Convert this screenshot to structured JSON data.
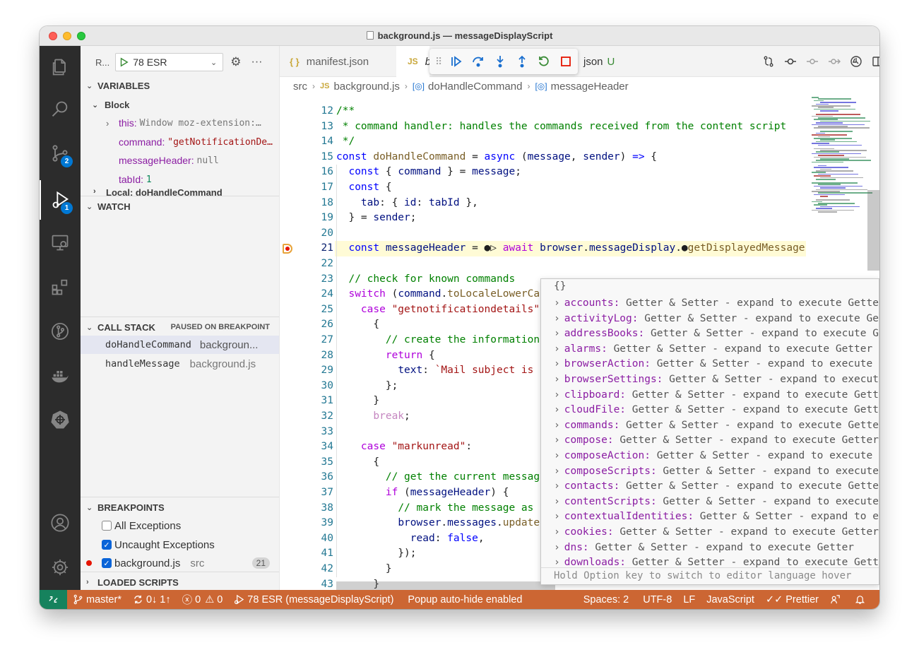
{
  "window": {
    "title": "background.js — messageDisplayScript"
  },
  "activity": {
    "scm_badge": "2",
    "debug_badge": "1"
  },
  "run": {
    "short_label": "R...",
    "config": "78 ESR"
  },
  "variables": {
    "header": "VARIABLES",
    "scope": "Block",
    "items": [
      {
        "name": "this:",
        "value": "Window moz-extension:…",
        "kind": "dim",
        "expandable": true
      },
      {
        "name": "command:",
        "value": "\"getNotificationDe…",
        "kind": "str",
        "expandable": false
      },
      {
        "name": "messageHeader:",
        "value": "null",
        "kind": "dim",
        "expandable": false
      },
      {
        "name": "tabId:",
        "value": "1",
        "kind": "num",
        "expandable": false
      }
    ],
    "local_scope": "Local: doHandleCommand"
  },
  "watch": {
    "header": "WATCH"
  },
  "callstack": {
    "header": "CALL STACK",
    "status": "PAUSED ON BREAKPOINT",
    "frames": [
      {
        "fn": "doHandleCommand",
        "file": "backgroun..."
      },
      {
        "fn": "handleMessage",
        "file": "background.js"
      }
    ]
  },
  "breakpoints": {
    "header": "BREAKPOINTS",
    "items": [
      {
        "label": "All Exceptions",
        "checked": false
      },
      {
        "label": "Uncaught Exceptions",
        "checked": true
      },
      {
        "label": "background.js",
        "checked": true,
        "path": "src",
        "line": "21"
      }
    ]
  },
  "loaded_scripts": {
    "header": "LOADED SCRIPTS"
  },
  "tabs": [
    {
      "icon": "{ }",
      "label": "manifest.json"
    },
    {
      "icon": "JS",
      "label": "b"
    },
    {
      "label": "json",
      "status": "U"
    }
  ],
  "breadcrumbs": [
    "src",
    "background.js",
    "doHandleCommand",
    "messageHeader"
  ],
  "code_lines": [
    {
      "n": "12",
      "html": "<span class='c'>/**</span>"
    },
    {
      "n": "13",
      "html": "<span class='c'> * command handler: handles the commands received from the content script</span>"
    },
    {
      "n": "14",
      "html": "<span class='c'> */</span>"
    },
    {
      "n": "15",
      "html": "<span class='k'>const</span> <span class='f'>doHandleCommand</span> = <span class='k'>async</span> (<span class='v'>message</span>, <span class='v'>sender</span>) <span class='k'>=&gt;</span> {"
    },
    {
      "n": "16",
      "html": "  <span class='k'>const</span> { <span class='v'>command</span> } = <span class='v'>message</span>;"
    },
    {
      "n": "17",
      "html": "  <span class='k'>const</span> {"
    },
    {
      "n": "18",
      "html": "    <span class='v'>tab</span>: { <span class='v'>id</span>: <span class='v'>tabId</span> },"
    },
    {
      "n": "19",
      "html": "  } = <span class='v'>sender</span>;"
    },
    {
      "n": "20",
      "html": ""
    },
    {
      "n": "21",
      "html": "  <span class='k'>const</span> <span class='v'>messageHeader</span> = ●▷ <span class='p'>await</span> <span class='v'>browser</span>.<span class='v'>messageDisplay</span>.●<span class='f'>getDisplayedMessage</span>",
      "current": true
    },
    {
      "n": "22",
      "html": ""
    },
    {
      "n": "23",
      "html": "  <span class='c'>// check for known commands</span>"
    },
    {
      "n": "24",
      "html": "  <span class='p'>switch</span> (<span class='v'>command</span>.<span class='f'>toLocaleLowerCas</span>"
    },
    {
      "n": "25",
      "html": "    <span class='p'>case</span> <span class='s'>\"getnotificationdetails\"</span>:"
    },
    {
      "n": "26",
      "html": "      {"
    },
    {
      "n": "27",
      "html": "        <span class='c'>// create the information</span>"
    },
    {
      "n": "28",
      "html": "        <span class='p'>return</span> {"
    },
    {
      "n": "29",
      "html": "          <span class='v'>text</span>: <span class='s'>`Mail subject is \"</span>"
    },
    {
      "n": "30",
      "html": "        };"
    },
    {
      "n": "31",
      "html": "      }"
    },
    {
      "n": "32",
      "html": "      <span class='dim'>break</span>;"
    },
    {
      "n": "33",
      "html": ""
    },
    {
      "n": "34",
      "html": "    <span class='p'>case</span> <span class='s'>\"markunread\"</span>:"
    },
    {
      "n": "35",
      "html": "      {"
    },
    {
      "n": "36",
      "html": "        <span class='c'>// get the current message</span>"
    },
    {
      "n": "37",
      "html": "        <span class='p'>if</span> (<span class='v'>messageHeader</span>) {"
    },
    {
      "n": "38",
      "html": "          <span class='c'>// mark the message as u</span>"
    },
    {
      "n": "39",
      "html": "          <span class='v'>browser</span>.<span class='v'>messages</span>.<span class='f'>update</span>("
    },
    {
      "n": "40",
      "html": "            <span class='v'>read</span>: <span class='k'>false</span>,"
    },
    {
      "n": "41",
      "html": "          });"
    },
    {
      "n": "42",
      "html": "        }"
    },
    {
      "n": "43",
      "html": "      }"
    }
  ],
  "hover": {
    "header": "{}",
    "items": [
      {
        "key": "accounts:",
        "val": "Getter & Setter - expand to execute Getter"
      },
      {
        "key": "activityLog:",
        "val": "Getter & Setter - expand to execute Getter"
      },
      {
        "key": "addressBooks:",
        "val": "Getter & Setter - expand to execute Getter"
      },
      {
        "key": "alarms:",
        "val": "Getter & Setter - expand to execute Getter"
      },
      {
        "key": "browserAction:",
        "val": "Getter & Setter - expand to execute Gette"
      },
      {
        "key": "browserSettings:",
        "val": "Getter & Setter - expand to execute Get"
      },
      {
        "key": "clipboard:",
        "val": "Getter & Setter - expand to execute Getter"
      },
      {
        "key": "cloudFile:",
        "val": "Getter & Setter - expand to execute Getter"
      },
      {
        "key": "commands:",
        "val": "Getter & Setter - expand to execute Getter"
      },
      {
        "key": "compose:",
        "val": "Getter & Setter - expand to execute Getter"
      },
      {
        "key": "composeAction:",
        "val": "Getter & Setter - expand to execute Gette"
      },
      {
        "key": "composeScripts:",
        "val": "Getter & Setter - expand to execute Gett"
      },
      {
        "key": "contacts:",
        "val": "Getter & Setter - expand to execute Getter"
      },
      {
        "key": "contentScripts:",
        "val": "Getter & Setter - expand to execute Gett"
      },
      {
        "key": "contextualIdentities:",
        "val": "Getter & Setter - expand to execut"
      },
      {
        "key": "cookies:",
        "val": "Getter & Setter - expand to execute Getter"
      },
      {
        "key": "dns:",
        "val": "Getter & Setter - expand to execute Getter"
      },
      {
        "key": "downloads:",
        "val": "Getter & Setter - expand to execute Getter"
      }
    ],
    "status": "Hold Option key to switch to editor language hover"
  },
  "statusbar": {
    "branch": "master*",
    "sync": "0↓ 1↑",
    "errors": "0",
    "warnings": "0",
    "debug": "78 ESR (messageDisplayScript)",
    "popup": "Popup auto-hide enabled",
    "spaces": "Spaces: 2",
    "encoding": "UTF-8",
    "eol": "LF",
    "language": "JavaScript",
    "prettier": "Prettier"
  },
  "colors": {
    "statusbar": "#cc6633",
    "remote": "#16825d",
    "activitybar": "#2c2c2c",
    "accent": "#0078d4"
  }
}
